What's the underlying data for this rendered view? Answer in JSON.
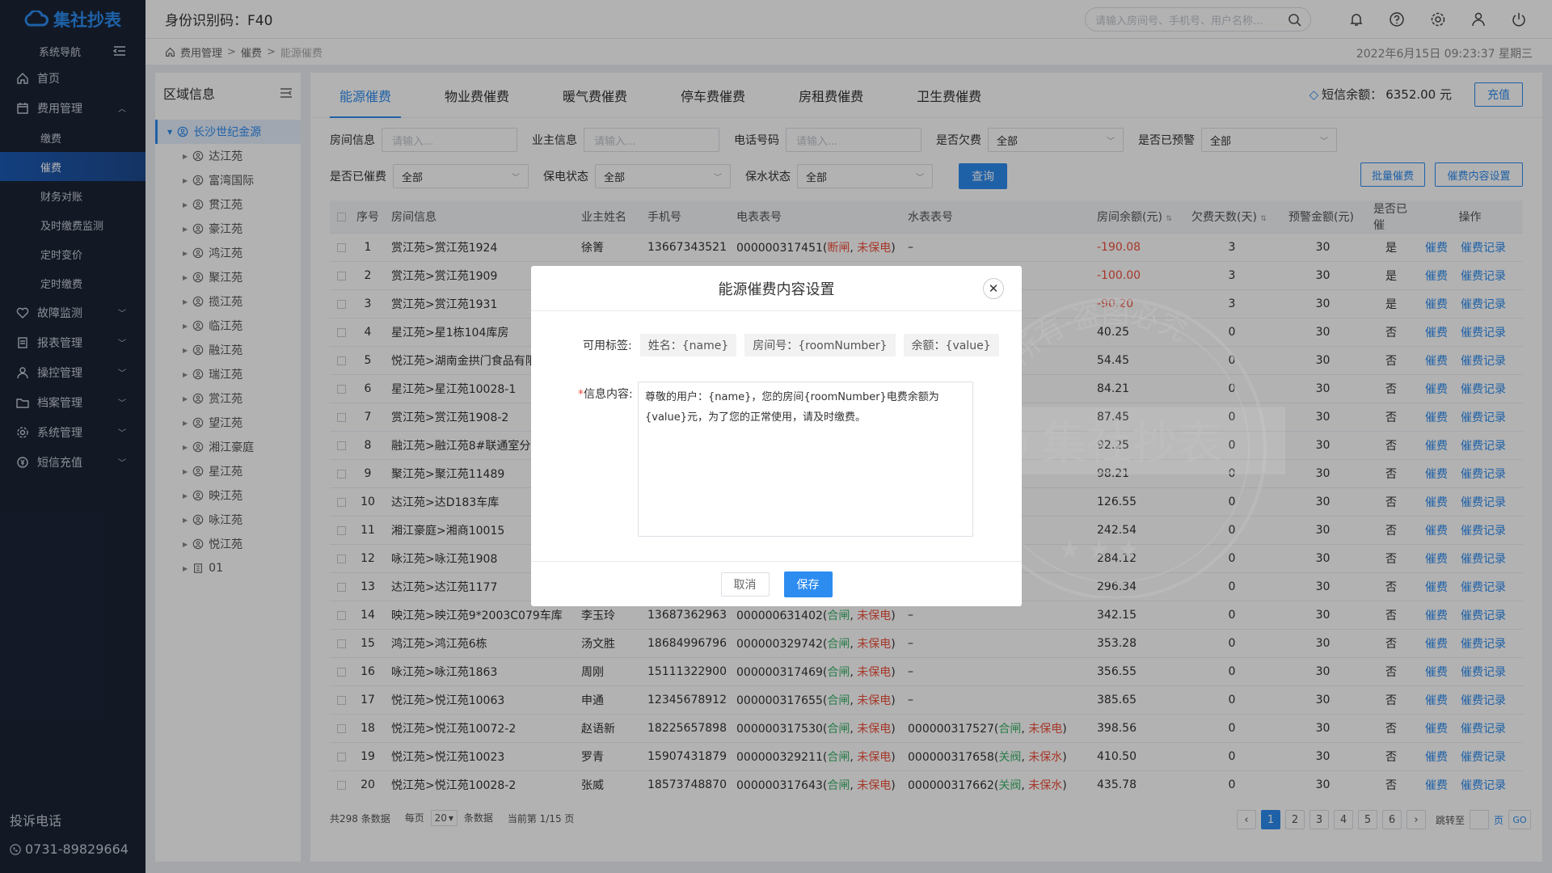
{
  "sidebar": {
    "logo": "集社抄表",
    "nav_label": "系统导航",
    "menu": [
      {
        "label": "首页",
        "icon": "home-icon"
      },
      {
        "label": "费用管理",
        "icon": "calendar-icon",
        "expanded": true,
        "children": [
          "缴费",
          "催费",
          "财务对账",
          "及时缴费监测",
          "定时变价",
          "定时缴费"
        ]
      },
      {
        "label": "故障监测",
        "icon": "heart-icon"
      },
      {
        "label": "报表管理",
        "icon": "report-icon"
      },
      {
        "label": "操控管理",
        "icon": "user-control-icon"
      },
      {
        "label": "档案管理",
        "icon": "folder-icon"
      },
      {
        "label": "系统管理",
        "icon": "gear-icon"
      },
      {
        "label": "短信充值",
        "icon": "coin-icon"
      }
    ],
    "active_sub": "催费",
    "complaint_label": "投诉电话",
    "complaint_phone": "0731-89829664"
  },
  "topbar": {
    "id_code": "身份识别码：F40",
    "search_placeholder": "请输入房间号、手机号、用户名称..."
  },
  "breadcrumb": {
    "items": [
      "费用管理",
      "催费",
      "能源催费"
    ],
    "datetime": "2022年6月15日 09:23:37 星期三"
  },
  "tree": {
    "title": "区域信息",
    "root": "长沙世纪金源",
    "nodes": [
      "达江苑",
      "富湾国际",
      "贯江苑",
      "豪江苑",
      "鸿江苑",
      "聚江苑",
      "揽江苑",
      "临江苑",
      "融江苑",
      "瑞江苑",
      "赏江苑",
      "望江苑",
      "湘江豪庭",
      "星江苑",
      "映江苑",
      "咏江苑",
      "悦江苑",
      "01"
    ]
  },
  "tabs": [
    "能源催费",
    "物业费催费",
    "暖气费催费",
    "停车费催费",
    "房租费催费",
    "卫生费催费"
  ],
  "active_tab": "能源催费",
  "sms": {
    "label": "短信余额：",
    "value": "6352.00 元",
    "recharge": "充值"
  },
  "filters": {
    "room_label": "房间信息",
    "room_placeholder": "请输入...",
    "owner_label": "业主信息",
    "owner_placeholder": "请输入...",
    "phone_label": "电话号码",
    "phone_placeholder": "请输入...",
    "arrears_label": "是否欠费",
    "arrears_value": "全部",
    "warn_label": "是否已预警",
    "warn_value": "全部",
    "urged_label": "是否已催费",
    "urged_value": "全部",
    "power_label": "保电状态",
    "power_value": "全部",
    "water_label": "保水状态",
    "water_value": "全部",
    "query": "查询",
    "batch": "批量催费",
    "settings": "催费内容设置"
  },
  "table": {
    "headers": [
      "序号",
      "房间信息",
      "业主姓名",
      "手机号",
      "电表表号",
      "水表表号",
      "房间余额(元)",
      "欠费天数(天)",
      "预警金额(元)",
      "是否已催",
      "操作"
    ],
    "action_urge": "催费",
    "action_record": "催费记录",
    "rows": [
      {
        "no": "1",
        "room": "赏江苑>赏江苑1924",
        "owner": "徐箐",
        "phone": "13667343521",
        "meter": "000000317451",
        "s1": "断闸",
        "s1c": "red",
        "s2": "未保电",
        "water": "–",
        "balance": "-190.08",
        "neg": true,
        "days": "3",
        "warn": "30",
        "urged": "是"
      },
      {
        "no": "2",
        "room": "赏江苑>赏江苑1909",
        "owner": "",
        "phone": "",
        "meter": "",
        "s1": "",
        "s1c": "",
        "s2": "",
        "water": "",
        "balance": "-100.00",
        "neg": true,
        "days": "3",
        "warn": "30",
        "urged": "是"
      },
      {
        "no": "3",
        "room": "赏江苑>赏江苑1931",
        "owner": "",
        "phone": "",
        "meter": "",
        "s1": "",
        "s1c": "",
        "s2": "",
        "water": "",
        "balance": "-90.20",
        "neg": true,
        "days": "3",
        "warn": "30",
        "urged": "是"
      },
      {
        "no": "4",
        "room": "星江苑>星1栋104库房",
        "owner": "",
        "phone": "",
        "meter": "",
        "s1": "",
        "s1c": "",
        "s2": "",
        "water": "",
        "balance": "40.25",
        "neg": false,
        "days": "0",
        "warn": "30",
        "urged": "否"
      },
      {
        "no": "5",
        "room": "悦江苑>湖南金拱门食品有限",
        "owner": "",
        "phone": "",
        "meter": "",
        "s1": "",
        "s1c": "",
        "s2": "",
        "water": "",
        "balance": "54.45",
        "neg": false,
        "days": "0",
        "warn": "30",
        "urged": "否"
      },
      {
        "no": "6",
        "room": "星江苑>星江苑10028-1",
        "owner": "",
        "phone": "",
        "meter": "",
        "s1": "",
        "s1c": "",
        "s2": "",
        "water": "",
        "balance": "84.21",
        "neg": false,
        "days": "0",
        "warn": "30",
        "urged": "否"
      },
      {
        "no": "7",
        "room": "赏江苑>赏江苑1908-2",
        "owner": "",
        "phone": "",
        "meter": "",
        "s1": "",
        "s1c": "",
        "s2": "",
        "water": "",
        "balance": "87.45",
        "neg": false,
        "days": "0",
        "warn": "30",
        "urged": "否"
      },
      {
        "no": "8",
        "room": "融江苑>融江苑8#联通室分",
        "owner": "",
        "phone": "",
        "meter": "",
        "s1": "",
        "s1c": "",
        "s2": "",
        "water": "",
        "balance": "92.25",
        "neg": false,
        "days": "0",
        "warn": "30",
        "urged": "否"
      },
      {
        "no": "9",
        "room": "聚江苑>聚江苑11489",
        "owner": "",
        "phone": "",
        "meter": "",
        "s1": "",
        "s1c": "",
        "s2": "",
        "water": "",
        "balance": "98.21",
        "neg": false,
        "days": "0",
        "warn": "30",
        "urged": "否"
      },
      {
        "no": "10",
        "room": "达江苑>达D183车库",
        "owner": "",
        "phone": "",
        "meter": "",
        "s1": "",
        "s1c": "",
        "s2": "",
        "water": "",
        "balance": "126.55",
        "neg": false,
        "days": "0",
        "warn": "30",
        "urged": "否"
      },
      {
        "no": "11",
        "room": "湘江豪庭>湘商10015",
        "owner": "",
        "phone": "",
        "meter": "",
        "s1": "",
        "s1c": "",
        "s2": "",
        "water": "",
        "balance": "242.54",
        "neg": false,
        "days": "0",
        "warn": "30",
        "urged": "否"
      },
      {
        "no": "12",
        "room": "咏江苑>咏江苑1908",
        "owner": "",
        "phone": "",
        "meter": "",
        "s1": "",
        "s1c": "",
        "s2": "",
        "water": "",
        "balance": "284.12",
        "neg": false,
        "days": "0",
        "warn": "30",
        "urged": "否"
      },
      {
        "no": "13",
        "room": "达江苑>达江苑1177",
        "owner": "",
        "phone": "",
        "meter": "",
        "s1": "",
        "s1c": "",
        "s2": "",
        "water": "",
        "balance": "296.34",
        "neg": false,
        "days": "0",
        "warn": "30",
        "urged": "否"
      },
      {
        "no": "14",
        "room": "映江苑>映江苑9*2003C079车库",
        "owner": "李玉玲",
        "phone": "13687362963",
        "meter": "000000631402",
        "s1": "合闸",
        "s1c": "green",
        "s2": "未保电",
        "water": "–",
        "balance": "342.15",
        "neg": false,
        "days": "0",
        "warn": "30",
        "urged": "否"
      },
      {
        "no": "15",
        "room": "鸿江苑>鸿江苑6栋",
        "owner": "汤文胜",
        "phone": "18684996796",
        "meter": "000000329742",
        "s1": "合闸",
        "s1c": "green",
        "s2": "未保电",
        "water": "–",
        "balance": "353.28",
        "neg": false,
        "days": "0",
        "warn": "30",
        "urged": "否"
      },
      {
        "no": "16",
        "room": "咏江苑>咏江苑1863",
        "owner": "周刚",
        "phone": "15111322900",
        "meter": "000000317469",
        "s1": "合闸",
        "s1c": "green",
        "s2": "未保电",
        "water": "–",
        "balance": "356.55",
        "neg": false,
        "days": "0",
        "warn": "30",
        "urged": "否"
      },
      {
        "no": "17",
        "room": "悦江苑>悦江苑10063",
        "owner": "申通",
        "phone": "12345678912",
        "meter": "000000317655",
        "s1": "合闸",
        "s1c": "green",
        "s2": "未保电",
        "water": "–",
        "balance": "385.65",
        "neg": false,
        "days": "0",
        "warn": "30",
        "urged": "否"
      },
      {
        "no": "18",
        "room": "悦江苑>悦江苑10072-2",
        "owner": "赵语新",
        "phone": "18225657898",
        "meter": "000000317530",
        "s1": "合闸",
        "s1c": "green",
        "s2": "未保电",
        "water": "000000317527",
        "ws1": "合闸",
        "ws1c": "green",
        "ws2": "未保电",
        "balance": "398.56",
        "neg": false,
        "days": "0",
        "warn": "30",
        "urged": "否"
      },
      {
        "no": "19",
        "room": "悦江苑>悦江苑10023",
        "owner": "罗青",
        "phone": "15907431879",
        "meter": "000000329211",
        "s1": "合闸",
        "s1c": "green",
        "s2": "未保电",
        "water": "000000317658",
        "ws1": "关阀",
        "ws1c": "green",
        "ws2": "未保水",
        "balance": "410.50",
        "neg": false,
        "days": "0",
        "warn": "30",
        "urged": "否"
      },
      {
        "no": "20",
        "room": "悦江苑>悦江苑10028-2",
        "owner": "张威",
        "phone": "18573748870",
        "meter": "000000317643",
        "s1": "合闸",
        "s1c": "green",
        "s2": "未保电",
        "water": "000000317662",
        "ws1": "关阀",
        "ws1c": "green",
        "ws2": "未保水",
        "balance": "435.78",
        "neg": false,
        "days": "0",
        "warn": "30",
        "urged": "否"
      }
    ]
  },
  "footer": {
    "total": "共298 条数据",
    "per_page_label": "每页",
    "per_page_value": "20",
    "per_page_unit": "条数据",
    "current": "当前第 1/15 页",
    "pages": [
      "1",
      "2",
      "3",
      "4",
      "5",
      "6"
    ],
    "jump_label": "跳转至",
    "page_unit": "页",
    "go": "GO"
  },
  "modal": {
    "title": "能源催费内容设置",
    "tags_label": "可用标签:",
    "tags": [
      "姓名：{name}",
      "房间号：{roomNumber}",
      "余额：{value}"
    ],
    "msg_required": "*",
    "msg_label": "信息内容:",
    "msg_content": "尊敬的用户：{name}，您的房间{roomNumber}电费余额为{value}元，为了您的正常使用，请及时缴费。",
    "cancel": "取消",
    "save": "保存"
  },
  "watermark": {
    "text": "集社抄表",
    "arc": "版权所有·盗图必究"
  },
  "colors": {
    "accent": "#2d8cf0",
    "sidebar": "#1b2436",
    "danger": "#f0503c",
    "success": "#3db36b"
  }
}
